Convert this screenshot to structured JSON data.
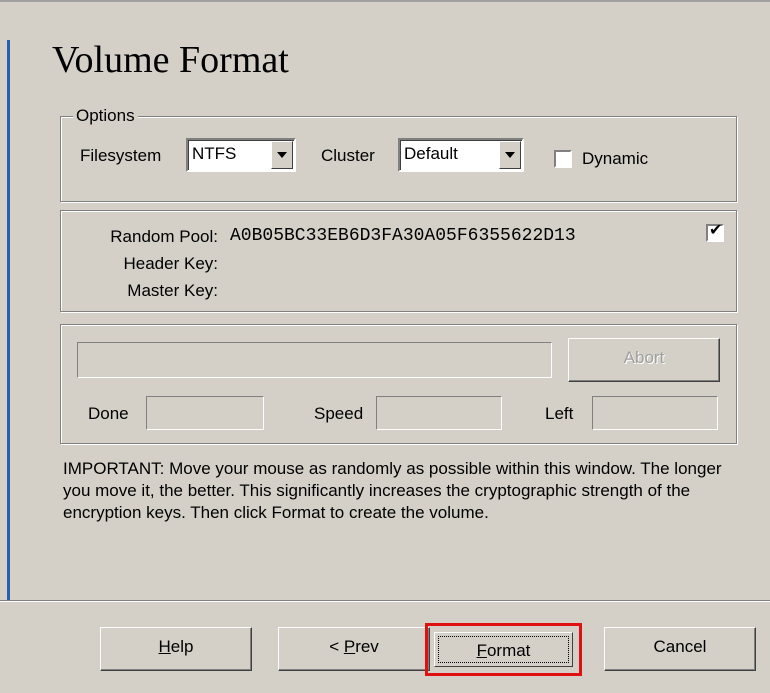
{
  "page": {
    "title": "Volume Format"
  },
  "options": {
    "legend": "Options",
    "filesystem_label": "Filesystem",
    "filesystem_value": "NTFS",
    "cluster_label": "Cluster",
    "cluster_value": "Default",
    "dynamic_label": "Dynamic",
    "dynamic_checked": false
  },
  "keys": {
    "random_pool_label": "Random Pool:",
    "random_pool_value": "A0B05BC33EB6D3FA30A05F6355622D13",
    "header_key_label": "Header Key:",
    "master_key_label": "Master Key:",
    "show_checked": true
  },
  "progress": {
    "abort_label": "Abort",
    "done_label": "Done",
    "speed_label": "Speed",
    "left_label": "Left"
  },
  "important_text": "IMPORTANT: Move your mouse as randomly as possible within this window. The longer you move it, the better. This significantly increases the cryptographic strength of the encryption keys. Then click Format to create the volume.",
  "buttons": {
    "help_prefix": "",
    "help_mnemonic": "H",
    "help_rest": "elp",
    "prev_prefix": "< ",
    "prev_mnemonic": "P",
    "prev_rest": "rev",
    "format_prefix": "",
    "format_mnemonic": "F",
    "format_rest": "ormat",
    "cancel_label": "Cancel"
  },
  "colors": {
    "highlight": "#e01010",
    "dialog_bg": "#d4d0c8",
    "accent_bar": "#2a5db0"
  }
}
